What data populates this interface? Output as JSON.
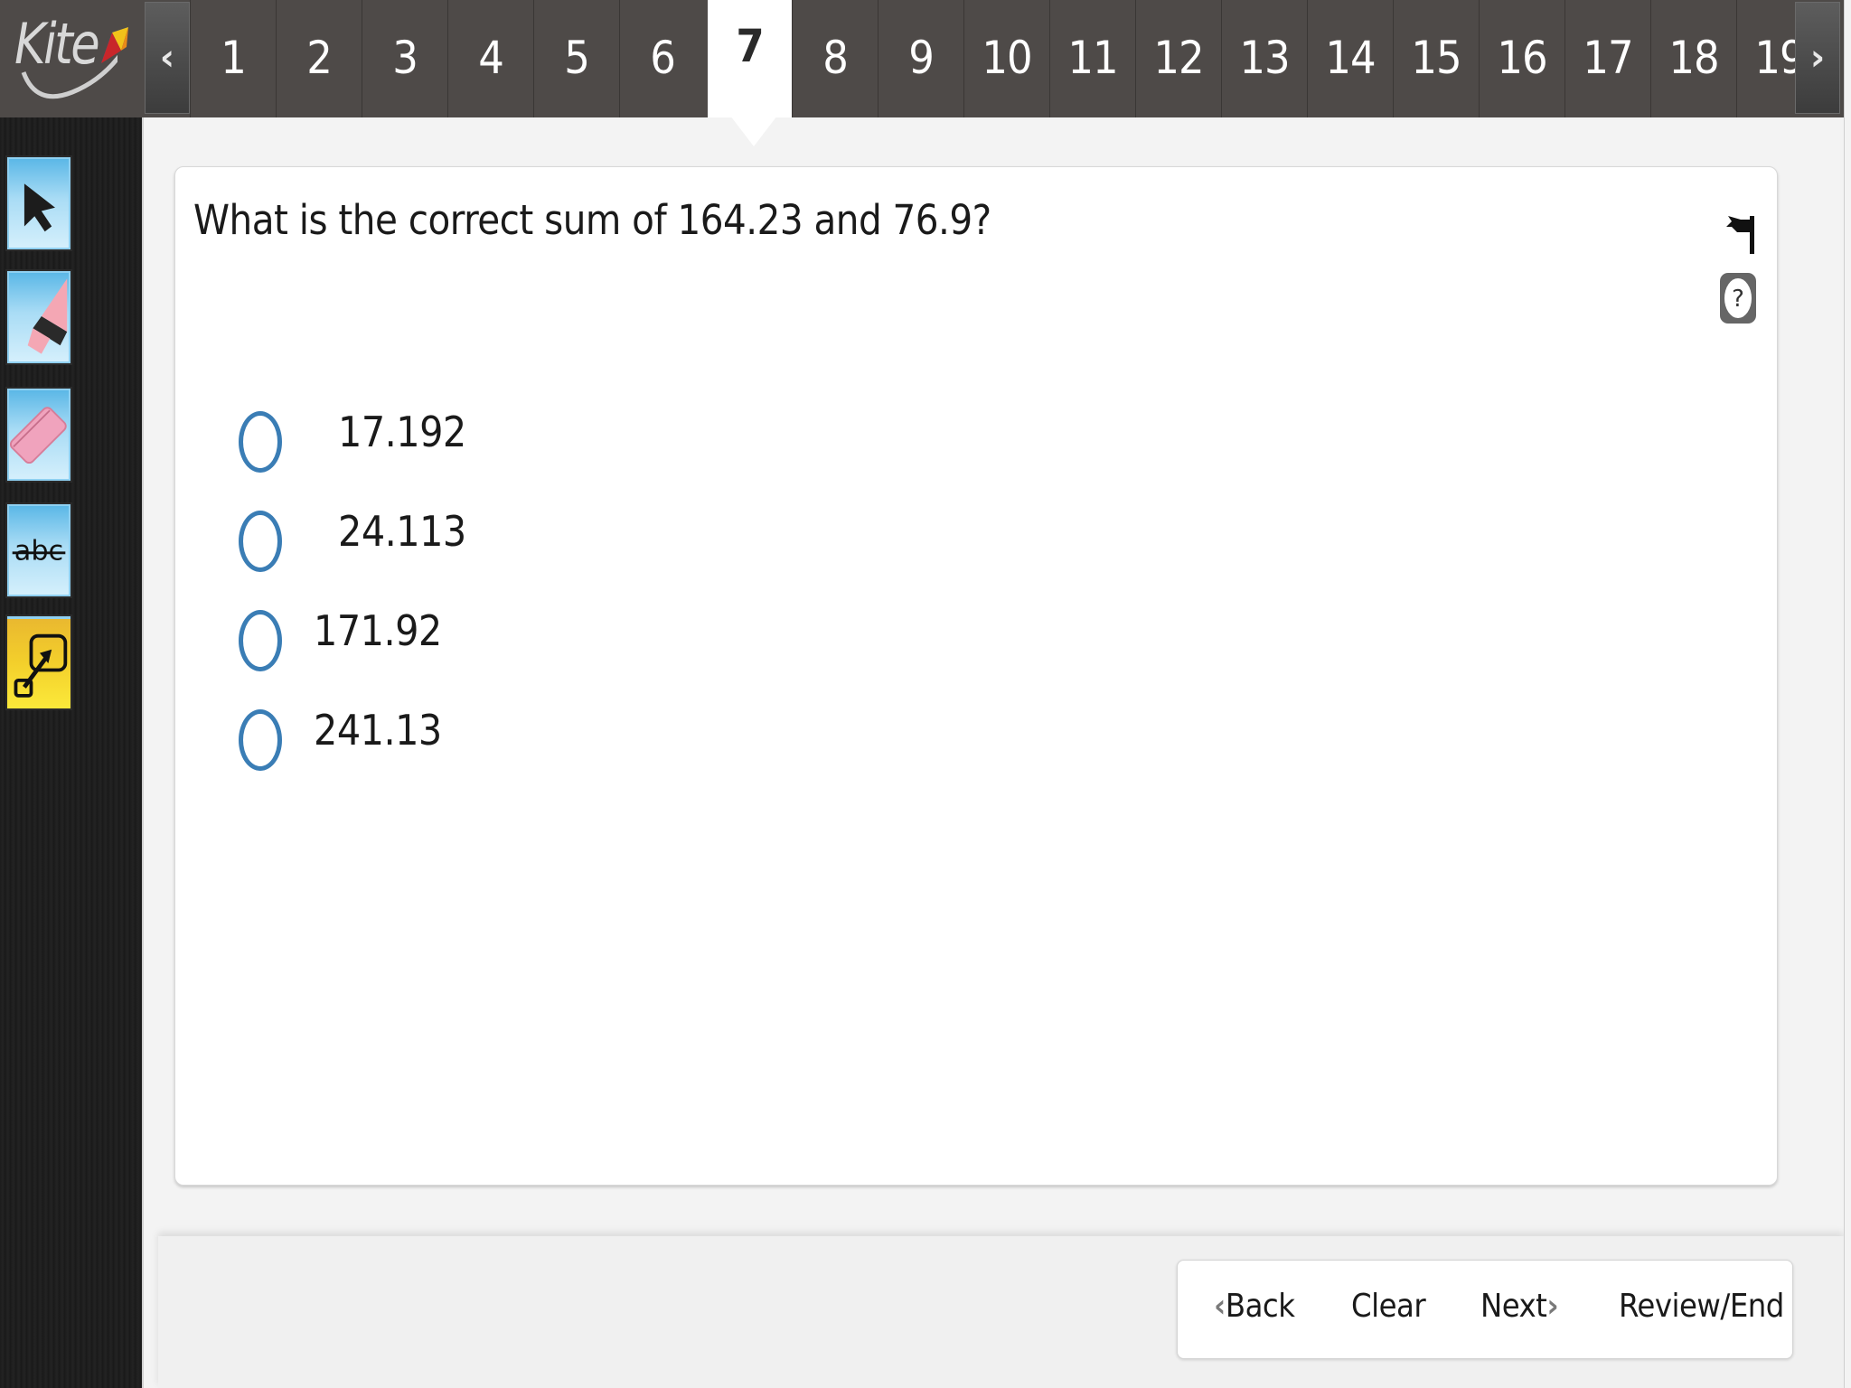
{
  "app": {
    "logo_text": "Kite",
    "icons": {
      "logo": "kite-logo-icon",
      "prev": "chevron-left-icon",
      "next": "chevron-right-icon"
    },
    "colors": {
      "topbar": "#4e4a48",
      "active_tab": "#ffffff",
      "radio_border": "#3a7db5",
      "tool_blue": "#8fd0f1",
      "tool_active_yellow": "#f3cf2b"
    }
  },
  "header": {
    "prev_label": "‹",
    "next_label": "›",
    "active_question": "7",
    "tabs": [
      {
        "label": "1"
      },
      {
        "label": "2"
      },
      {
        "label": "3"
      },
      {
        "label": "4"
      },
      {
        "label": "5"
      },
      {
        "label": "6"
      },
      {
        "label": "7"
      },
      {
        "label": "8"
      },
      {
        "label": "9"
      },
      {
        "label": "10"
      },
      {
        "label": "11"
      },
      {
        "label": "12"
      },
      {
        "label": "13"
      },
      {
        "label": "14"
      },
      {
        "label": "15"
      },
      {
        "label": "16"
      },
      {
        "label": "17"
      },
      {
        "label": "18"
      },
      {
        "label": "19"
      }
    ]
  },
  "toolbar": {
    "tools": [
      {
        "name": "pointer",
        "icon": "pointer-arrow-icon"
      },
      {
        "name": "highlighter",
        "icon": "highlighter-icon"
      },
      {
        "name": "eraser",
        "icon": "eraser-icon"
      },
      {
        "name": "strikethrough",
        "icon": "strikethrough-icon",
        "label": "abc"
      },
      {
        "name": "magnify",
        "icon": "expand-icon",
        "active": true
      }
    ]
  },
  "question": {
    "text": "What is the correct sum of 164.23 and 76.9?",
    "flag_icon": "flag-icon",
    "help_icon": "help-question-icon",
    "options": [
      {
        "label": "17.192",
        "selected": false
      },
      {
        "label": "24.113",
        "selected": false
      },
      {
        "label": "171.92",
        "selected": false
      },
      {
        "label": "241.13",
        "selected": false
      }
    ]
  },
  "footer": {
    "back_chevron": "‹",
    "back_label": "Back",
    "clear_label": "Clear",
    "next_label": "Next",
    "next_chevron": "›",
    "review_label": "Review/End"
  }
}
